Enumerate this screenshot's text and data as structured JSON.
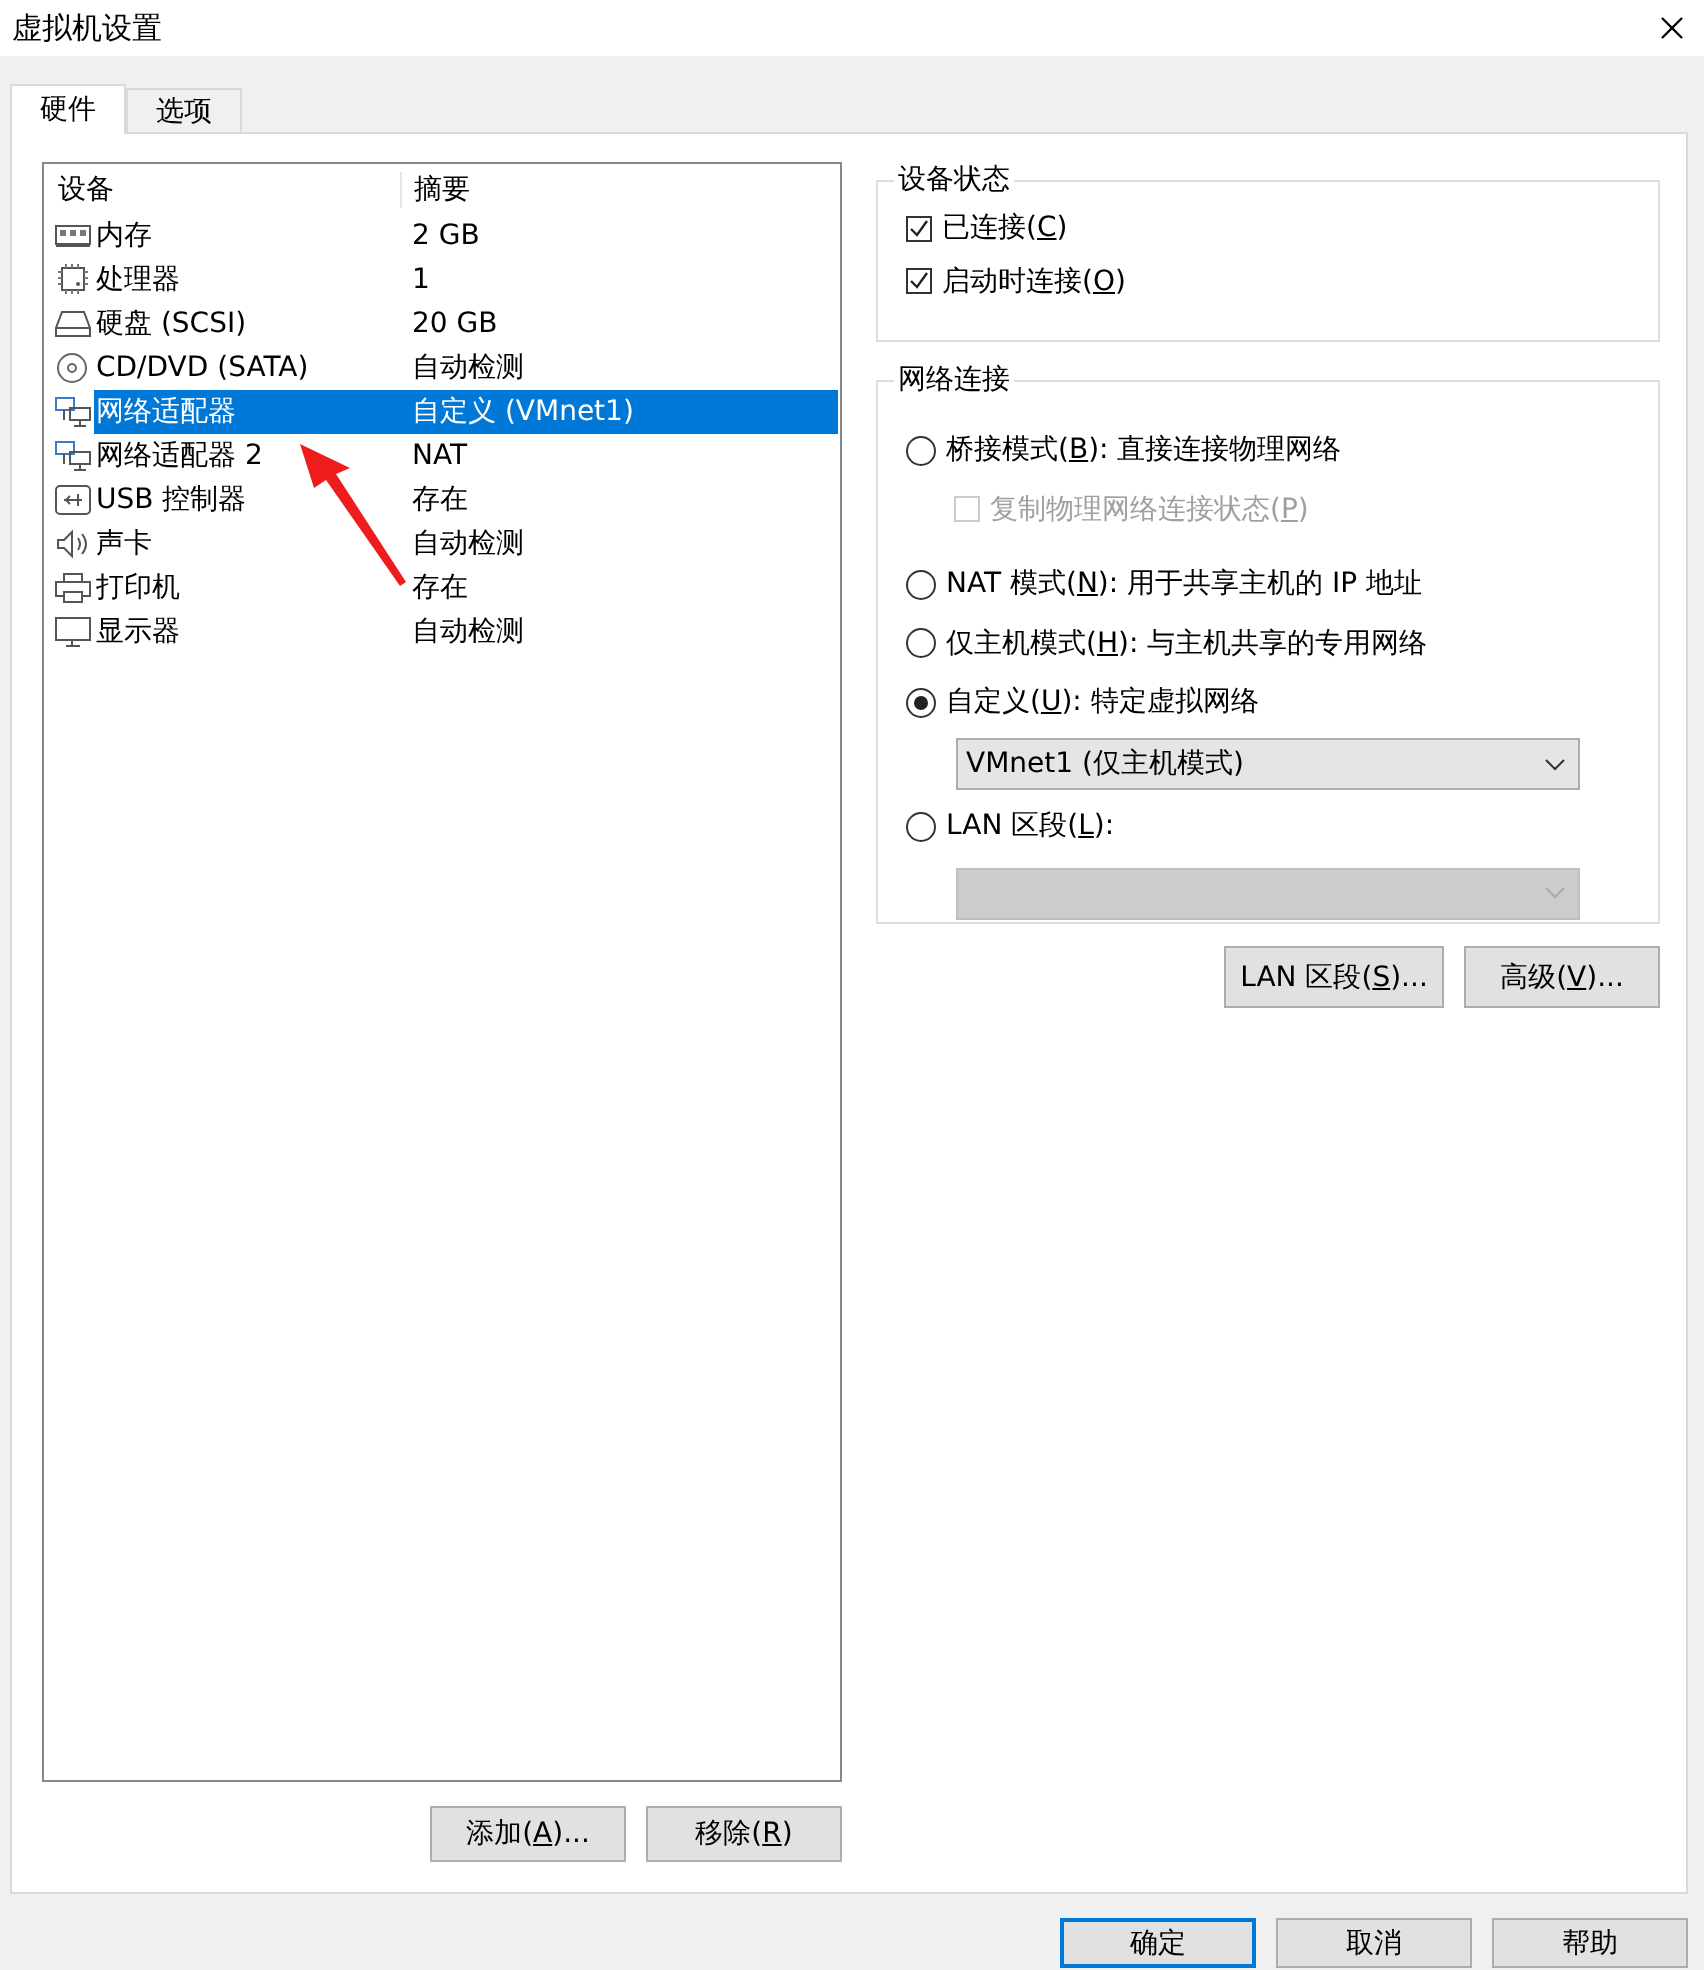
{
  "window": {
    "title": "虚拟机设置"
  },
  "tabs": [
    {
      "label": "硬件",
      "selected": true
    },
    {
      "label": "选项",
      "selected": false
    }
  ],
  "device_list": {
    "columns": [
      "设备",
      "摘要"
    ],
    "rows": [
      {
        "kind": "memory",
        "device": "内存",
        "summary": "2 GB",
        "selected": false
      },
      {
        "kind": "cpu",
        "device": "处理器",
        "summary": "1",
        "selected": false
      },
      {
        "kind": "disk",
        "device": "硬盘 (SCSI)",
        "summary": "20 GB",
        "selected": false
      },
      {
        "kind": "cdrom",
        "device": "CD/DVD (SATA)",
        "summary": "自动检测",
        "selected": false
      },
      {
        "kind": "network",
        "device": "网络适配器",
        "summary": "自定义 (VMnet1)",
        "selected": true
      },
      {
        "kind": "network",
        "device": "网络适配器 2",
        "summary": "NAT",
        "selected": false
      },
      {
        "kind": "usb",
        "device": "USB 控制器",
        "summary": "存在",
        "selected": false
      },
      {
        "kind": "sound",
        "device": "声卡",
        "summary": "自动检测",
        "selected": false
      },
      {
        "kind": "printer",
        "device": "打印机",
        "summary": "存在",
        "selected": false
      },
      {
        "kind": "display",
        "device": "显示器",
        "summary": "自动检测",
        "selected": false
      }
    ]
  },
  "device_buttons": [
    {
      "before": "添加(",
      "key": "A",
      "after": ")..."
    },
    {
      "before": "移除(",
      "key": "R",
      "after": ")"
    }
  ],
  "device_status": {
    "title": "设备状态",
    "options": [
      {
        "before": "已连接(",
        "key": "C",
        "after": ")",
        "checked": true
      },
      {
        "before": "启动时连接(",
        "key": "O",
        "after": ")",
        "checked": true
      }
    ]
  },
  "network": {
    "title": "网络连接",
    "options": [
      {
        "kind": "radio",
        "before": "桥接模式(",
        "key": "B",
        "after": "): 直接连接物理网络",
        "selected": false
      },
      {
        "kind": "checkbox",
        "before": "复制物理网络连接状态(",
        "key": "P",
        "after": ")",
        "checked": false,
        "disabled": true
      },
      {
        "kind": "radio",
        "before": "NAT 模式(",
        "key": "N",
        "after": "): 用于共享主机的 IP 地址",
        "selected": false
      },
      {
        "kind": "radio",
        "before": "仅主机模式(",
        "key": "H",
        "after": "): 与主机共享的专用网络",
        "selected": false
      },
      {
        "kind": "radio",
        "before": "自定义(",
        "key": "U",
        "after": "): 特定虚拟网络",
        "selected": true
      },
      {
        "kind": "select",
        "value": "VMnet1 (仅主机模式)",
        "disabled": false
      },
      {
        "kind": "radio",
        "before": "LAN 区段(",
        "key": "L",
        "after": "):",
        "selected": false
      },
      {
        "kind": "select",
        "disabled": true
      }
    ]
  },
  "network_buttons": [
    {
      "before": "LAN 区段(",
      "key": "S",
      "after": ")..."
    },
    {
      "before": "高级(",
      "key": "V",
      "after": ")..."
    }
  ],
  "dialog_buttons": [
    {
      "before": "确定",
      "default": true
    },
    {
      "before": "取消",
      "default": false
    },
    {
      "before": "帮助",
      "default": false
    }
  ]
}
